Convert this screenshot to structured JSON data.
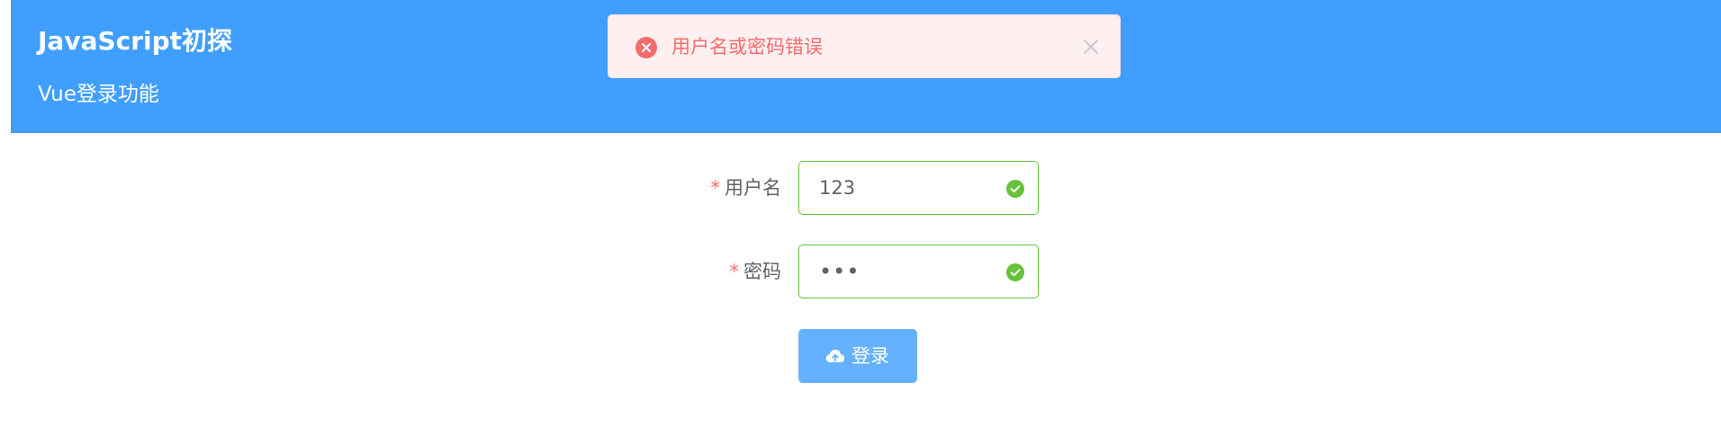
{
  "header": {
    "title": "JavaScript初探",
    "subtitle": "Vue登录功能"
  },
  "message": {
    "text": "用户名或密码错误",
    "type": "error",
    "icon": "error-circle-icon",
    "close_icon": "close-icon"
  },
  "form": {
    "username": {
      "label": "用户名",
      "required_mark": "*",
      "value": "123",
      "status_icon": "check-circle-icon"
    },
    "password": {
      "label": "密码",
      "required_mark": "*",
      "value": "123",
      "status_icon": "check-circle-icon"
    },
    "submit": {
      "label": "登录",
      "icon": "cloud-upload-icon"
    }
  },
  "colors": {
    "header_bg": "#409eff",
    "error_text": "#f56c6c",
    "error_bg": "#fef0f0",
    "success": "#67c23a",
    "button_bg": "#66b1ff"
  }
}
